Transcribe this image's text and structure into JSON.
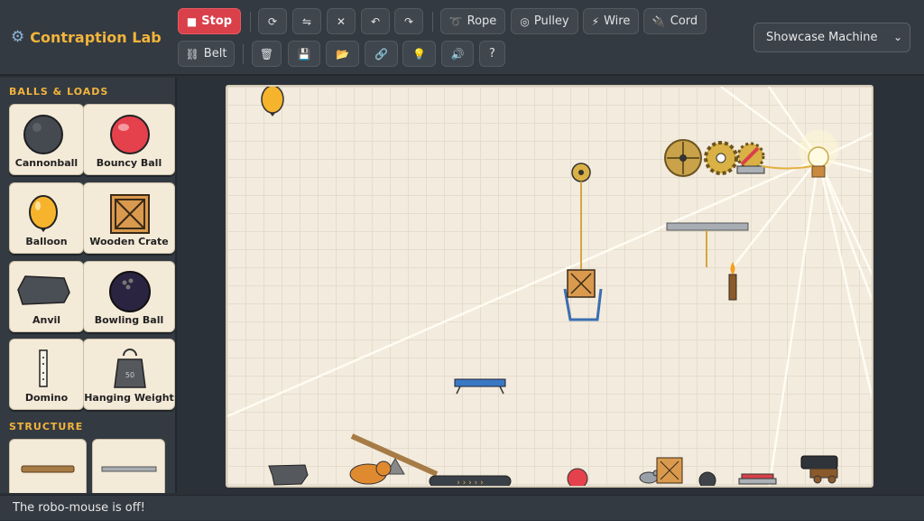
{
  "app": {
    "title": "Contraption Lab"
  },
  "toolbar": {
    "stop_label": "Stop",
    "rope_label": "Rope",
    "pulley_label": "Pulley",
    "wire_label": "Wire",
    "cord_label": "Cord",
    "belt_label": "Belt",
    "help_label": "?",
    "icons": {
      "stop": "■",
      "rotate": "⟳",
      "flip": "⇋",
      "delete": "✕",
      "undo": "↶",
      "redo": "↷",
      "rope": "➰",
      "pulley": "◎",
      "wire": "⚡",
      "cord": "🔌",
      "belt": "⛓",
      "trash": "🗑",
      "save": "💾",
      "open": "📂",
      "link": "🔗",
      "hint": "💡",
      "sound": "🔊"
    }
  },
  "machine_select": {
    "selected": "Showcase Machine"
  },
  "sidebar": {
    "sections": {
      "balls_loads": "BALLS & LOADS",
      "structure": "STRUCTURE"
    },
    "items": [
      {
        "label": "Cannonball"
      },
      {
        "label": "Bouncy Ball"
      },
      {
        "label": "Balloon"
      },
      {
        "label": "Wooden Crate"
      },
      {
        "label": "Anvil"
      },
      {
        "label": "Bowling Ball"
      },
      {
        "label": "Domino"
      },
      {
        "label": "Hanging Weight",
        "badge": "50"
      }
    ]
  },
  "status": {
    "message": "The robo-mouse is off!"
  },
  "colors": {
    "accent": "#f2b43c",
    "stop": "#d9404a",
    "board": "#f3ebdd"
  }
}
